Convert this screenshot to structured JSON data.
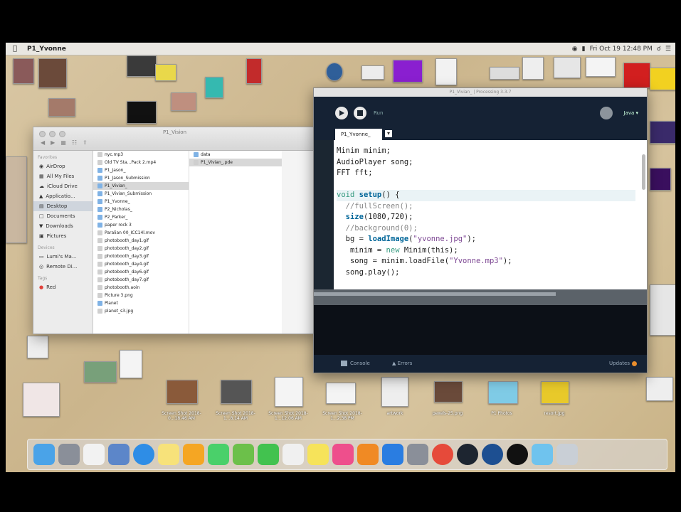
{
  "menubar": {
    "app_name": "P1_Yvonne",
    "status": "Fri Oct 19  12:48 PM"
  },
  "finder": {
    "title": "P1_Vision",
    "sidebar": {
      "favorites_header": "Favorites",
      "items": [
        {
          "label": "AirDrop",
          "icon": "airdrop-icon"
        },
        {
          "label": "All My Files",
          "icon": "all-files-icon"
        },
        {
          "label": "iCloud Drive",
          "icon": "cloud-icon"
        },
        {
          "label": "Applicatio...",
          "icon": "applications-icon"
        },
        {
          "label": "Desktop",
          "icon": "desktop-icon",
          "selected": true
        },
        {
          "label": "Documents",
          "icon": "documents-icon"
        },
        {
          "label": "Downloads",
          "icon": "downloads-icon"
        },
        {
          "label": "Pictures",
          "icon": "pictures-icon"
        }
      ],
      "devices_header": "Devices",
      "devices": [
        {
          "label": "Lumi's Ma...",
          "icon": "laptop-icon"
        },
        {
          "label": "Remote Di...",
          "icon": "disc-icon"
        }
      ],
      "tags_header": "Tags",
      "tags": [
        {
          "label": "Red",
          "color": "#e0413a"
        }
      ]
    },
    "column1": [
      "nyc.mp3",
      "Old TV Sta...Pack 2.mp4",
      "P1_Jason_",
      "P1_Jason_Submission",
      "P1_Vivian_",
      "P1_Vivian_Submission",
      "P1_Yvonne_",
      "P2_Nicholas_",
      "P2_Parker_",
      "paper rock 3",
      "Paralian 00_ICC14l.mov",
      "photobooth_day1.gif",
      "photobooth_day2.gif",
      "photobooth_day3.gif",
      "photobooth_day4.gif",
      "photobooth_day6.gif",
      "photobooth_day7.gif",
      "photobooth.aoin",
      "Picture 3.png",
      "Planet",
      "planet_s3.jpg"
    ],
    "column1_selected": 4,
    "column2": [
      "data",
      "P1_Vivian_.pde"
    ],
    "column2_selected": 1
  },
  "processing": {
    "window_title": "P1_Vivian_ | Processing 3.3.7",
    "run_label": "Run",
    "mode_label": "Java ▾",
    "tab_label": "P1_Yvonne_",
    "line_numbers": [
      "",
      "",
      "",
      "",
      "",
      "",
      "",
      "",
      "",
      "",
      "",
      "",
      ""
    ],
    "code_lines": [
      "Minim minim;",
      "AudioPlayer song;",
      "FFT fft;",
      "",
      "void setup() {",
      "  //fullScreen();",
      "  size(1080,720);",
      "  //background(0);",
      "  bg = loadImage(\"yvonne.jpg\");",
      "   minim = new Minim(this);",
      "   song = minim.loadFile(\"Yvonne.mp3\");",
      "  song.play();"
    ],
    "console_label": "Console",
    "errors_label": "Errors",
    "updates_label": "Updates"
  },
  "desktop": {
    "labels": [
      "Screen Shot 2018-0...18.46 AM",
      "Screen Shot 2018-1...8.14 AM",
      "Screen Shot 2018-1...12.06 AM",
      "Screen Shot 2018-1...2.38 PM",
      "artwork",
      "pexels-25.png",
      "P1 Photos",
      "resort.jpg"
    ]
  },
  "dock": {
    "icons": [
      "finder-icon",
      "launchpad-icon",
      "calendar-icon",
      "preview-icon",
      "safari-icon",
      "notes-icon",
      "photos-icon",
      "messages-icon",
      "maps-icon",
      "facetime-icon",
      "reminders-icon",
      "stickies-icon",
      "itunes-icon",
      "ibooks-icon",
      "appstore-icon",
      "system-prefs-icon",
      "chrome-icon",
      "processing-icon",
      "quicktime-icon",
      "obs-icon",
      "folder-icon",
      "trash-icon"
    ]
  },
  "colors": {
    "editor_bg": "#ffffff",
    "pde_header": "#152234",
    "keyword": "#33997e",
    "function": "#006699",
    "string": "#7d4793"
  }
}
